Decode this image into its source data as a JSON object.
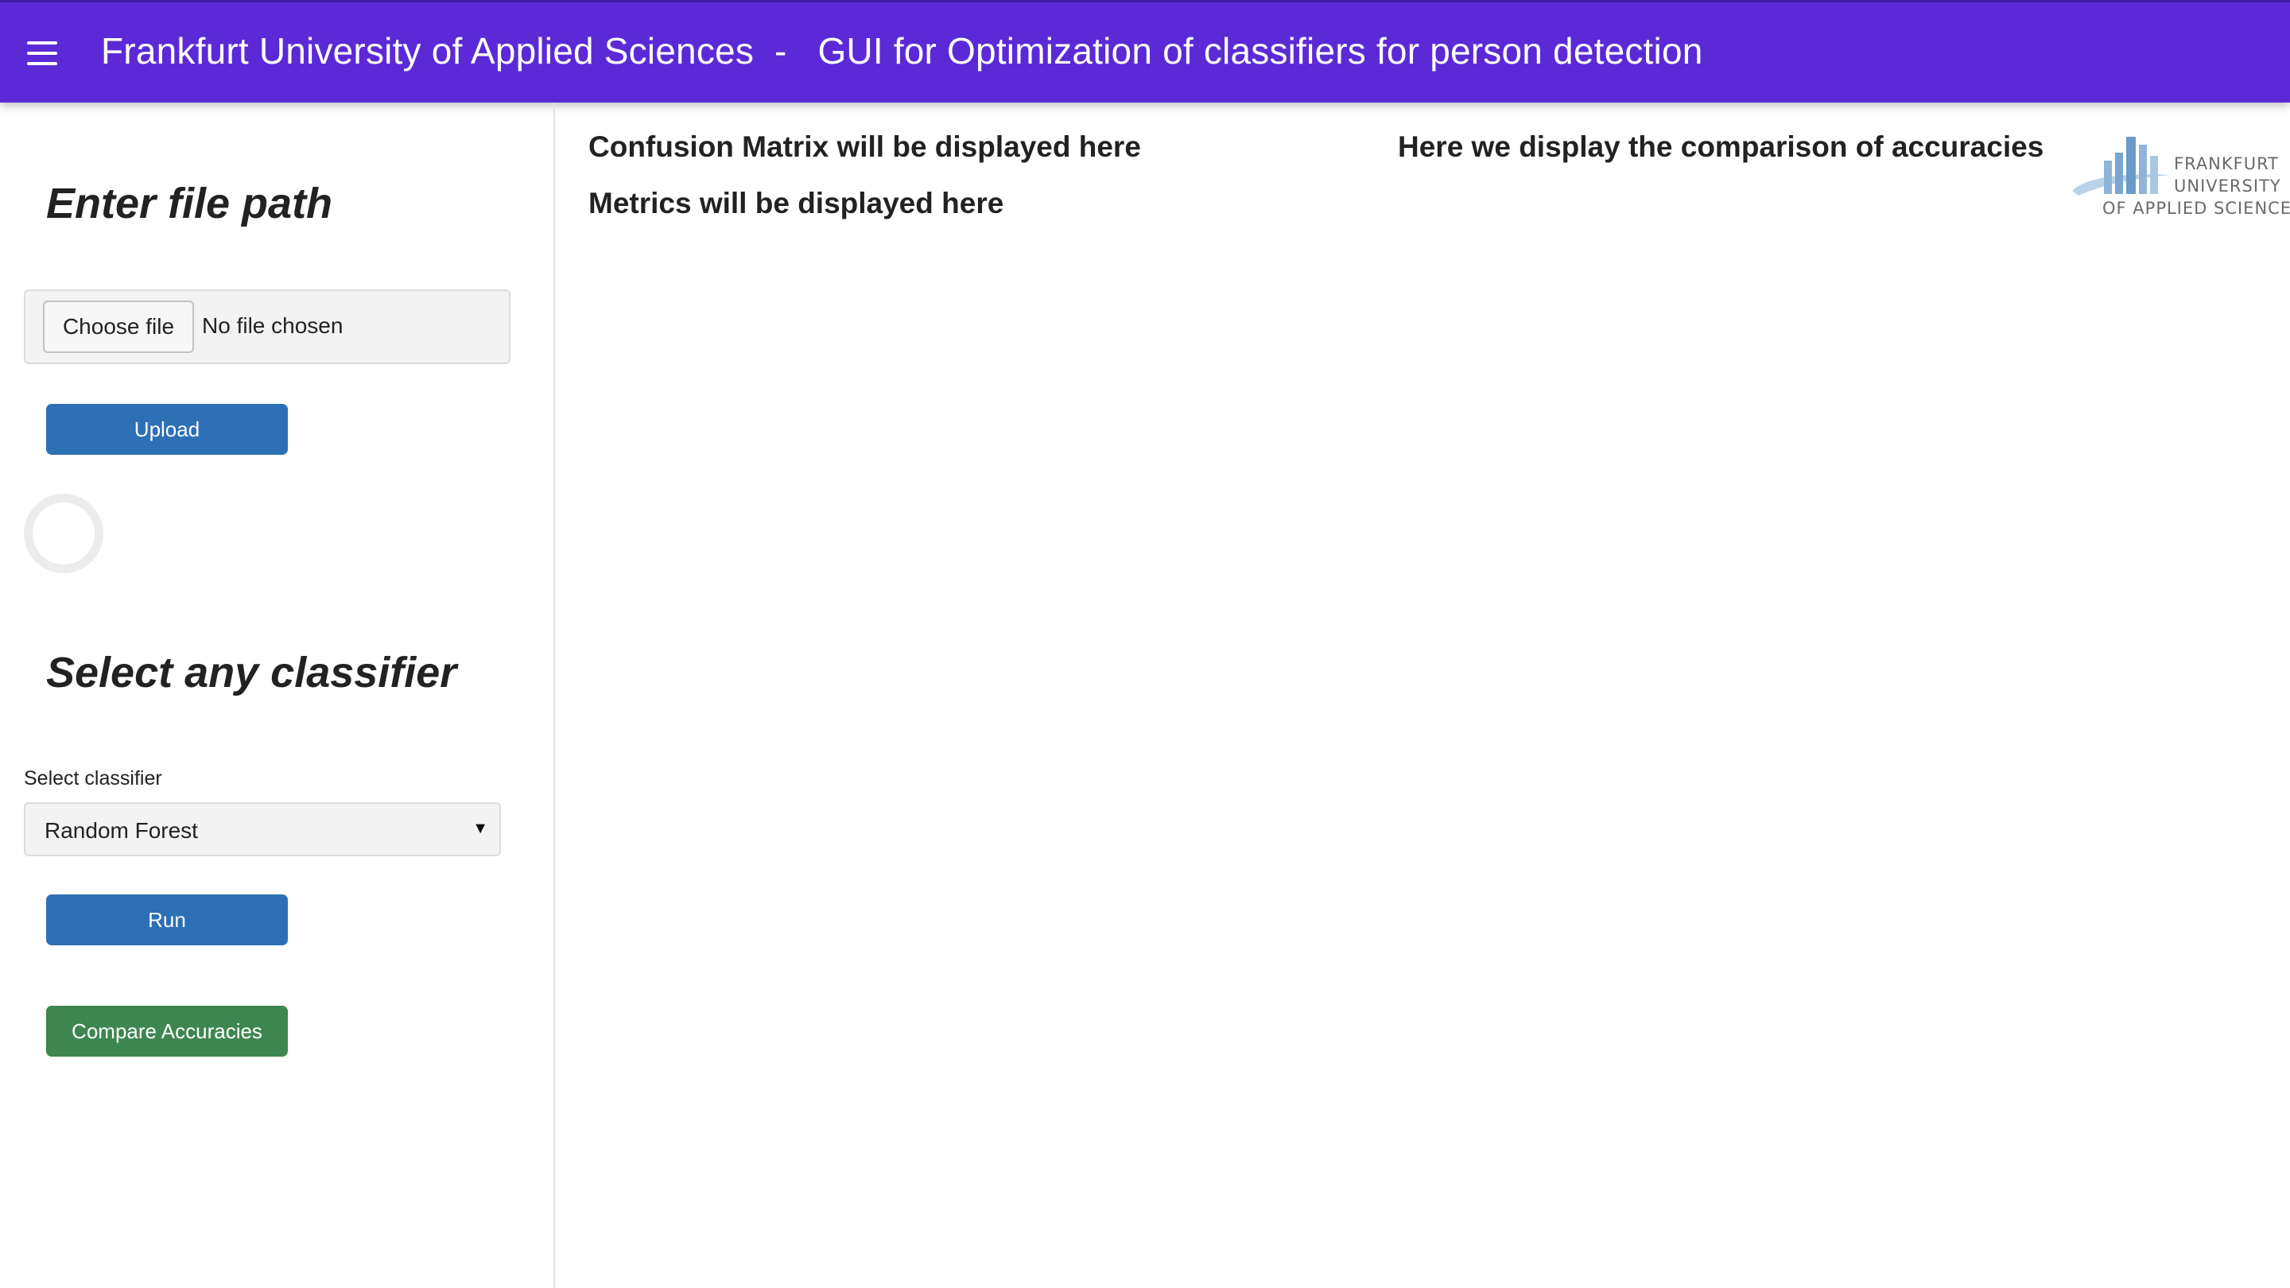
{
  "header": {
    "title": "Frankfurt University of Applied Sciences  -   GUI for Optimization of classifiers for person detection",
    "menu_icon": "hamburger-menu-icon",
    "background_color": "#5b2ad6"
  },
  "sidebar": {
    "file_section_heading": "Enter file path",
    "file_input": {
      "button_label": "Choose file",
      "status_text": "No file chosen"
    },
    "upload_button": "Upload",
    "classifier_section_heading": "Select any classifier",
    "select_label": "Select classifier",
    "select_value": "Random Forest",
    "run_button": "Run",
    "compare_button": "Compare Accuracies",
    "colors": {
      "primary_button": "#2d70b5",
      "compare_button": "#3e8650"
    }
  },
  "main": {
    "confusion_matrix_placeholder": "Confusion Matrix will be displayed here",
    "metrics_placeholder": "Metrics will be displayed here",
    "comparison_placeholder": "Here we display the comparison of accuracies"
  },
  "logo": {
    "line1": "FRANKFURT",
    "line2": "UNIVERSITY",
    "line3": "OF APPLIED SCIENCES",
    "icon": "university-logo-icon"
  }
}
